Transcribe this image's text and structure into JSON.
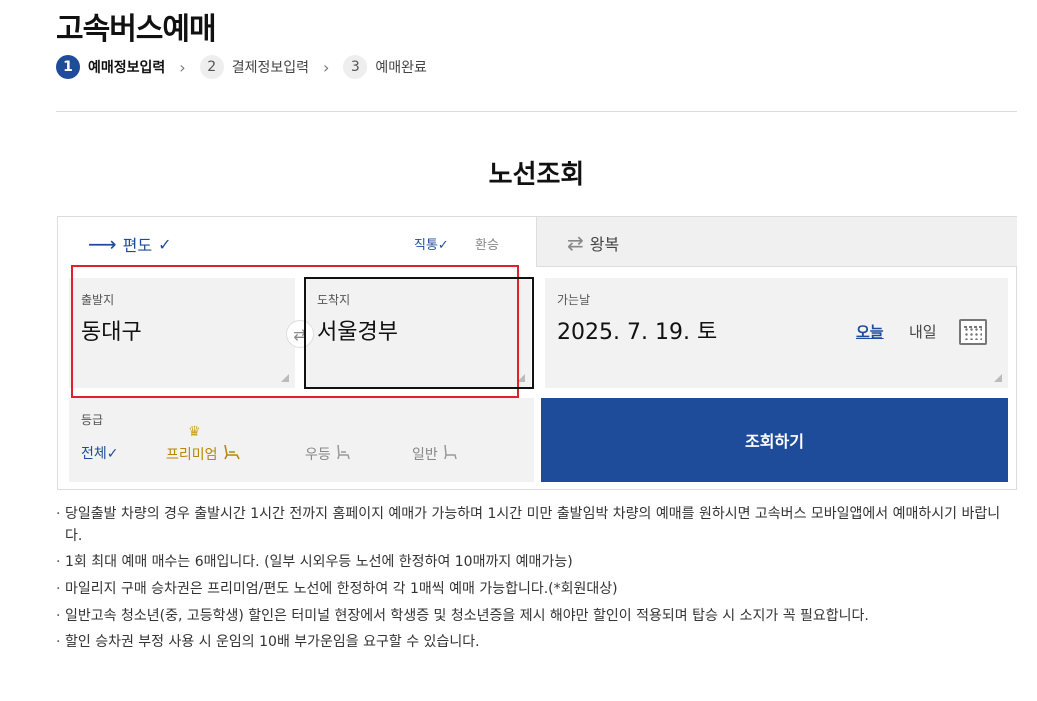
{
  "page_title": "고속버스예매",
  "steps": [
    {
      "num": "1",
      "label": "예매정보입력"
    },
    {
      "num": "2",
      "label": "결제정보입력"
    },
    {
      "num": "3",
      "label": "예매완료"
    }
  ],
  "step_arrow": "›",
  "section_title": "노선조회",
  "trip_tabs": {
    "oneway": {
      "label": "편도",
      "arrow": "⟶",
      "check": "✓"
    },
    "direct": "직통✓",
    "transfer": "환승",
    "round": {
      "label": "왕복",
      "arrow": "⇄"
    }
  },
  "departure": {
    "label": "출발지",
    "value": "동대구"
  },
  "arrival": {
    "label": "도착지",
    "value": "서울경부"
  },
  "swap_symbol": "⇄",
  "date": {
    "label": "가는날",
    "value": "2025. 7. 19. 토",
    "today": "오늘",
    "tomorrow": "내일"
  },
  "grade": {
    "label": "등급",
    "options": [
      {
        "label": "전체✓"
      },
      {
        "label": "프리미엄",
        "icon": "♛"
      },
      {
        "label": "우등"
      },
      {
        "label": "일반"
      }
    ]
  },
  "search_button": "조회하기",
  "notices": [
    "당일출발 차량의 경우 출발시간 1시간 전까지 홈페이지 예매가 가능하며 1시간 미만 출발임박 차량의 예매를 원하시면 고속버스 모바일앱에서 예매하시기 바랍니다.",
    "1회 최대 예매 매수는 6매입니다. (일부 시외우등 노선에 한정하여 10매까지 예매가능)",
    "마일리지 구매 승차권은 프리미엄/편도 노선에 한정하여 각 1매씩 예매 가능합니다.(*회원대상)",
    "일반고속 청소년(중, 고등학생) 할인은 터미널 현장에서 학생증 및 청소년증을 제시 해야만 할인이 적용되며 탑승 시 소지가 꼭 필요합니다.",
    "할인 승차권 부정 사용 시 운임의 10배 부가운임을 요구할 수 있습니다."
  ],
  "colors": {
    "primary": "#1f4c9a",
    "premium": "#b8860b",
    "highlight_red": "#e0202a"
  }
}
